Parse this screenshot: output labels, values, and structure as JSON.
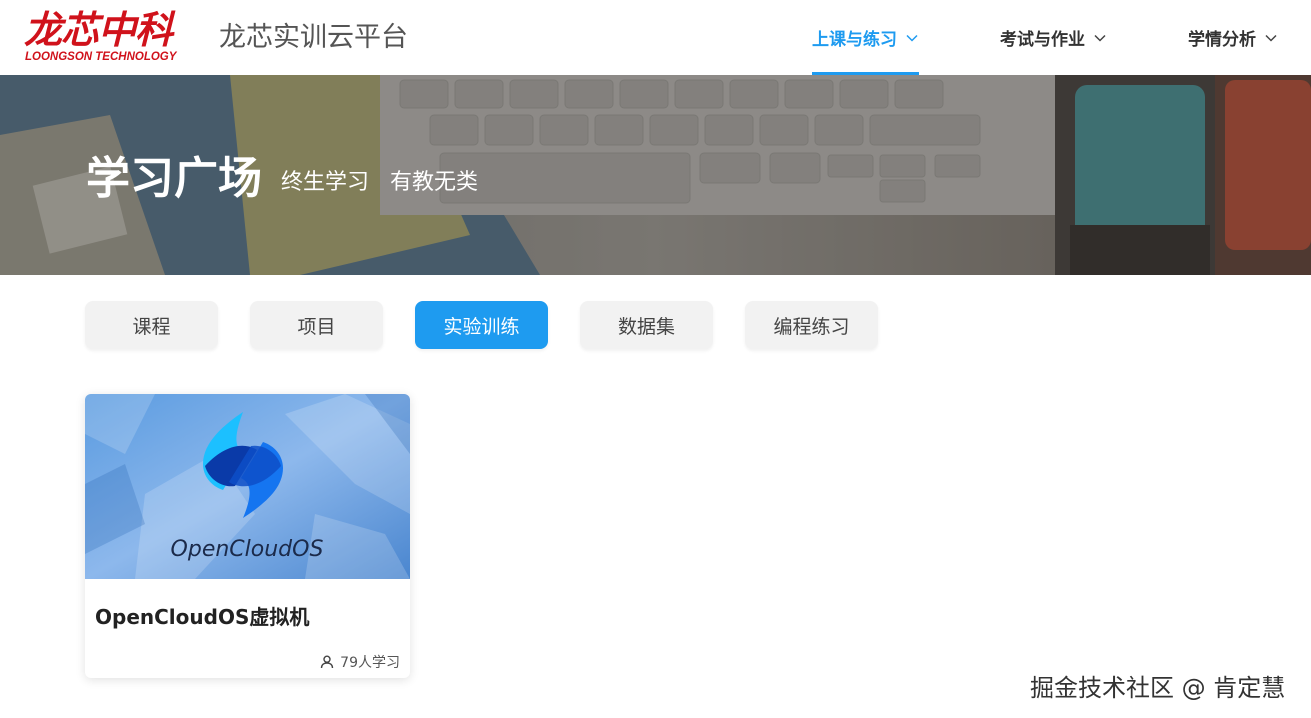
{
  "brand": {
    "logo_cn": "龙芯中科",
    "logo_en": "LOONGSON TECHNOLOGY",
    "platform_title": "龙芯实训云平台",
    "brand_color": "#d0121b"
  },
  "nav": {
    "items": [
      {
        "label": "上课与练习",
        "active": true
      },
      {
        "label": "考试与作业",
        "active": false
      },
      {
        "label": "学情分析",
        "active": false
      }
    ],
    "accent_color": "#1e9bf0"
  },
  "banner": {
    "title": "学习广场",
    "subtitle": "终生学习 有教无类"
  },
  "tabs": [
    {
      "label": "课程",
      "active": false
    },
    {
      "label": "项目",
      "active": false
    },
    {
      "label": "实验训练",
      "active": true
    },
    {
      "label": "数据集",
      "active": false
    },
    {
      "label": "编程练习",
      "active": false
    }
  ],
  "cards": [
    {
      "image_text": "OpenCloudOS",
      "title": "OpenCloudOS虚拟机",
      "learners": "79人学习",
      "icon": "user-icon"
    }
  ],
  "watermark": "掘金技术社区 @ 肯定慧"
}
